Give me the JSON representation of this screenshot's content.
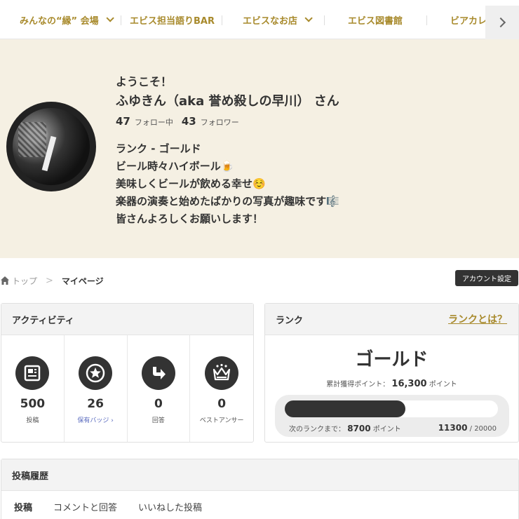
{
  "nav": {
    "items": [
      {
        "label": "みんなの“縁” 会場",
        "has_dropdown": true
      },
      {
        "label": "エビス担当語りBAR",
        "has_dropdown": false
      },
      {
        "label": "エビスなお店",
        "has_dropdown": true
      },
      {
        "label": "エビス図書館",
        "has_dropdown": false
      },
      {
        "label": "ビアカレ",
        "has_dropdown": false
      }
    ],
    "next_icon": "chevron-right-icon",
    "accent_color": "#a88a2c"
  },
  "profile": {
    "welcome": "ようこそ！",
    "name": "ふゆきん（aka 誉め殺しの早川） さん",
    "following_count": "47",
    "following_label": "フォロー中",
    "followers_count": "43",
    "followers_label": "フォロワー",
    "bio": [
      "ランク - ゴールド",
      "ビール時々ハイボール🍺",
      "美味しくビールが飲める幸せ☺️",
      "楽器の演奏と始めたばかりの写真が趣味です🎼",
      "皆さんよろしくお願いします！"
    ],
    "background_color": "#f5f0e3"
  },
  "breadcrumb": {
    "home_icon": "home-icon",
    "top": "トップ",
    "separator": ">",
    "current": "マイページ"
  },
  "account_button": "アカウント設定",
  "activity": {
    "title": "アクティビティ",
    "stats": [
      {
        "icon": "document-icon",
        "value": "500",
        "label": "投稿"
      },
      {
        "icon": "star-badge-icon",
        "value": "26",
        "label": "保有バッジ"
      },
      {
        "icon": "reply-arrow-icon",
        "value": "0",
        "label": "回答"
      },
      {
        "icon": "crown-icon",
        "value": "0",
        "label": "ベストアンサー"
      }
    ]
  },
  "rank": {
    "title": "ランク",
    "what_link": "ランクとは？",
    "name": "ゴールド",
    "points_label": "累計獲得ポイント：",
    "points_value": "16,300",
    "points_unit": "ポイント",
    "next_label": "次のランクまで：",
    "next_value": "8700",
    "next_unit": "ポイント",
    "current": "11300",
    "separator": "/",
    "target": "20000",
    "progress_fraction": 0.565
  },
  "history": {
    "title": "投稿履歴",
    "tabs": [
      "投稿",
      "コメントと回答",
      "いいねした投稿"
    ]
  }
}
